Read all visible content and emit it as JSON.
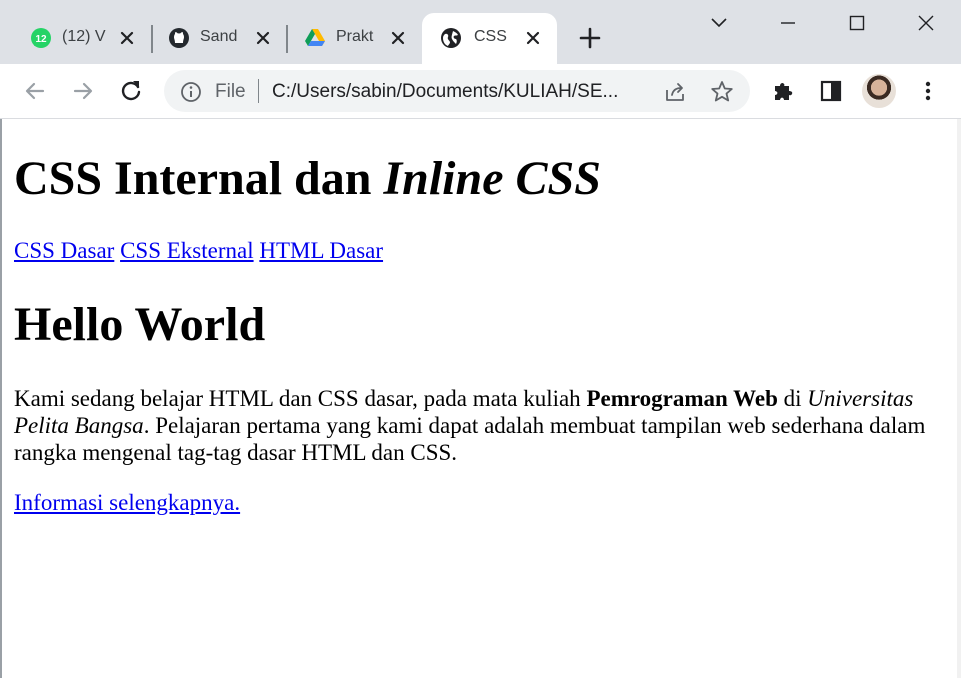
{
  "browser": {
    "tabs": [
      {
        "title": "(12) V",
        "icon": "whatsapp-icon",
        "badge": "12"
      },
      {
        "title": "Sand",
        "icon": "github-icon"
      },
      {
        "title": "Prakt",
        "icon": "google-drive-icon"
      },
      {
        "title": "CSS I",
        "icon": "globe-icon",
        "active": true
      }
    ],
    "omnibox": {
      "scheme_label": "File",
      "url": "C:/Users/sabin/Documents/KULIAH/SE..."
    }
  },
  "page": {
    "title_plain": "CSS Internal dan ",
    "title_italic": "Inline CSS",
    "nav_links": [
      "CSS Dasar",
      "CSS Eksternal",
      "HTML Dasar"
    ],
    "heading": "Hello World",
    "paragraph": {
      "text1": "Kami sedang belajar HTML dan CSS dasar, pada mata kuliah ",
      "bold": "Pemrograman Web",
      "text2": " di ",
      "italic": "Universitas Pelita Bangsa",
      "text3": ". Pelajaran pertama yang kami dapat adalah membuat tampilan web sederhana dalam rangka mengenal tag-tag dasar HTML dan CSS."
    },
    "more_link": "Informasi selengkapnya."
  },
  "colors": {
    "link": "#0000ee",
    "tabstrip": "#dee1e6",
    "omnibox": "#f1f3f4",
    "whatsapp_green": "#25d366"
  }
}
